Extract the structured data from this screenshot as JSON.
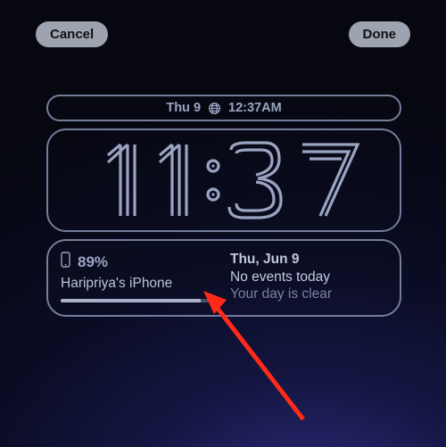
{
  "topbar": {
    "cancel": "Cancel",
    "done": "Done"
  },
  "datePill": {
    "left": "Thu 9",
    "right": "12:37AM",
    "iconName": "globe-icon"
  },
  "clock": {
    "time": "11:37"
  },
  "widgets": {
    "battery": {
      "percentText": "89%",
      "percent": 89,
      "deviceName": "Haripriya's iPhone",
      "iconName": "iphone-icon"
    },
    "calendar": {
      "dateText": "Thu, Jun 9",
      "line1": "No events today",
      "line2": "Your day is clear"
    }
  },
  "colors": {
    "frameBorder": "#747d9b",
    "text": "#9aa4c2",
    "arrow": "#ff2a1a"
  }
}
